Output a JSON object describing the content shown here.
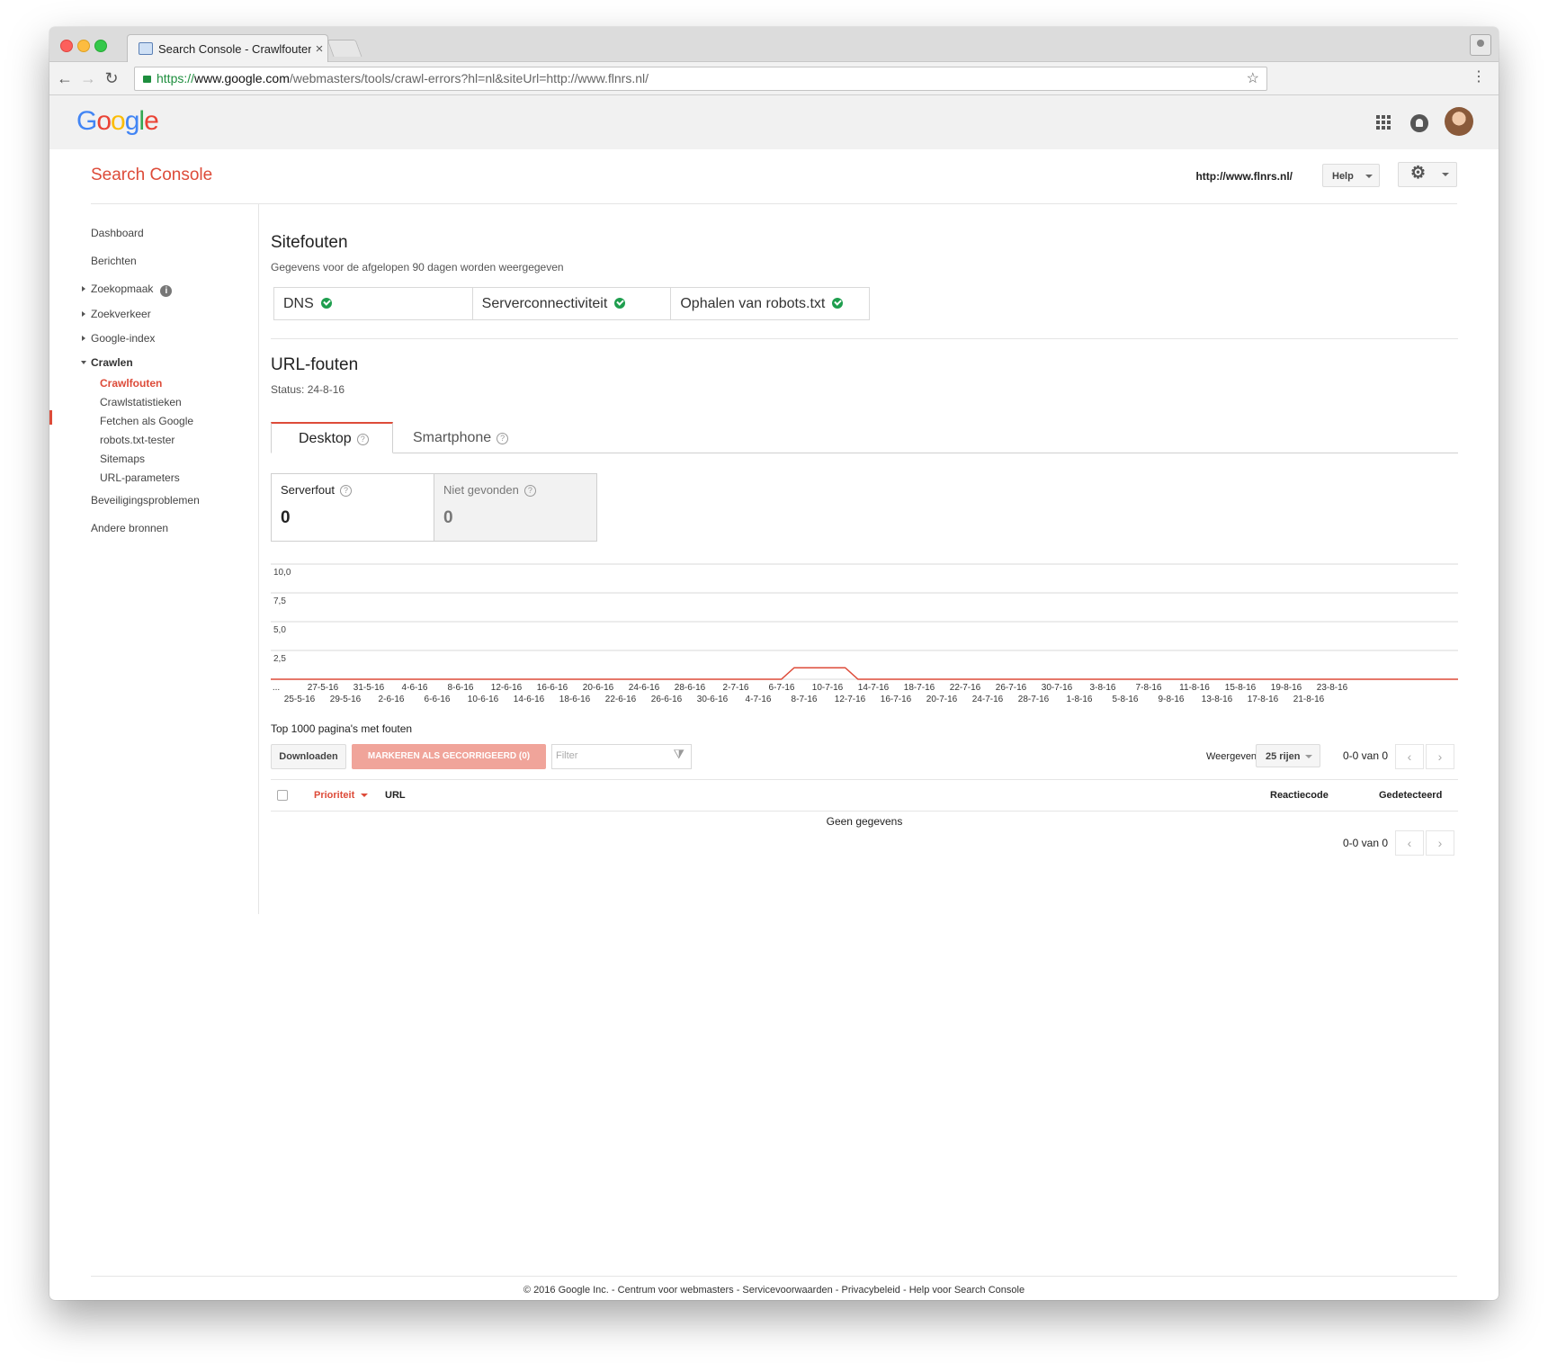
{
  "browser": {
    "tab_title": "Search Console - Crawlfouten",
    "url": {
      "scheme": "https://",
      "domain": "www.google.com",
      "path": "/webmasters/tools/crawl-errors?hl=nl&siteUrl=http://www.flnrs.nl/"
    }
  },
  "google_logo": [
    "G",
    "o",
    "o",
    "g",
    "l",
    "e"
  ],
  "logo_colors": [
    "#4285f4",
    "#ea4335",
    "#fbbc05",
    "#4285f4",
    "#34a853",
    "#ea4335"
  ],
  "header": {
    "product": "Search Console",
    "site": "http://www.flnrs.nl/",
    "help_label": "Help"
  },
  "sidebar": {
    "items": [
      {
        "label": "Dashboard"
      },
      {
        "label": "Berichten"
      },
      {
        "label": "Zoekopmaak"
      },
      {
        "label": "Zoekverkeer"
      },
      {
        "label": "Google-index"
      },
      {
        "label": "Crawlen"
      },
      {
        "label": "Crawlfouten"
      },
      {
        "label": "Crawlstatistieken"
      },
      {
        "label": "Fetchen als Google"
      },
      {
        "label": "robots.txt-tester"
      },
      {
        "label": "Sitemaps"
      },
      {
        "label": "URL-parameters"
      },
      {
        "label": "Beveiligingsproblemen"
      },
      {
        "label": "Andere bronnen"
      }
    ]
  },
  "site_errors": {
    "title": "Sitefouten",
    "subtitle": "Gegevens voor de afgelopen 90 dagen worden weergegeven",
    "checks": [
      "DNS",
      "Serverconnectiviteit",
      "Ophalen van robots.txt"
    ]
  },
  "url_errors": {
    "title": "URL-fouten",
    "status": "Status: 24-8-16",
    "tabs": [
      "Desktop",
      "Smartphone"
    ],
    "metrics": [
      {
        "label": "Serverfout",
        "value": "0"
      },
      {
        "label": "Niet gevonden",
        "value": "0"
      }
    ]
  },
  "chart_data": {
    "type": "line",
    "y_ticks": [
      "10,0",
      "7,5",
      "5,0",
      "2,5"
    ],
    "ylim": [
      0,
      10
    ],
    "x_labels_top": [
      "...",
      "27-5-16",
      "31-5-16",
      "4-6-16",
      "8-6-16",
      "12-6-16",
      "16-6-16",
      "20-6-16",
      "24-6-16",
      "28-6-16",
      "2-7-16",
      "6-7-16",
      "10-7-16",
      "14-7-16",
      "18-7-16",
      "22-7-16",
      "26-7-16",
      "30-7-16",
      "3-8-16",
      "7-8-16",
      "11-8-16",
      "15-8-16",
      "19-8-16",
      "23-8-16"
    ],
    "x_labels_bottom": [
      "25-5-16",
      "29-5-16",
      "2-6-16",
      "6-6-16",
      "10-6-16",
      "14-6-16",
      "18-6-16",
      "22-6-16",
      "26-6-16",
      "30-6-16",
      "4-7-16",
      "8-7-16",
      "12-7-16",
      "16-7-16",
      "20-7-16",
      "24-7-16",
      "28-7-16",
      "1-8-16",
      "5-8-16",
      "9-8-16",
      "13-8-16",
      "17-8-16",
      "21-8-16"
    ],
    "series": [
      {
        "color": "#dd4b39",
        "values": [
          0,
          0,
          0,
          0,
          0,
          0,
          0,
          0,
          0,
          0,
          0,
          0,
          0,
          0,
          0,
          0,
          0,
          0,
          0,
          0,
          0,
          0,
          0,
          0,
          0,
          0,
          0,
          0,
          0,
          0,
          0,
          0,
          0,
          0,
          0,
          0,
          0,
          0,
          0,
          0,
          0,
          1,
          1,
          1,
          1,
          1,
          0,
          0,
          0,
          0,
          0,
          0,
          0,
          0,
          0,
          0,
          0,
          0,
          0,
          0,
          0,
          0,
          0,
          0,
          0,
          0,
          0,
          0,
          0,
          0,
          0,
          0,
          0,
          0,
          0,
          0,
          0,
          0,
          0,
          0,
          0,
          0,
          0,
          0,
          0,
          0,
          0,
          0,
          0,
          0,
          0,
          0,
          0,
          0
        ]
      }
    ]
  },
  "table": {
    "heading": "Top 1000 pagina's met fouten",
    "download": "Downloaden",
    "mark_fixed": "MARKEREN ALS GECORRIGEERD (0)",
    "filter_placeholder": "Filter",
    "show_label": "Weergeven",
    "rows_select": "25 rijen",
    "range": "0-0 van 0",
    "columns": [
      "Prioriteit",
      "URL",
      "Reactiecode",
      "Gedetecteerd"
    ],
    "empty": "Geen gegevens"
  },
  "footer": {
    "copyright": "© 2016 Google Inc.",
    "sep": " - ",
    "links": [
      "Centrum voor webmasters",
      "Servicevoorwaarden",
      "Privacybeleid",
      "Help voor Search Console"
    ]
  }
}
